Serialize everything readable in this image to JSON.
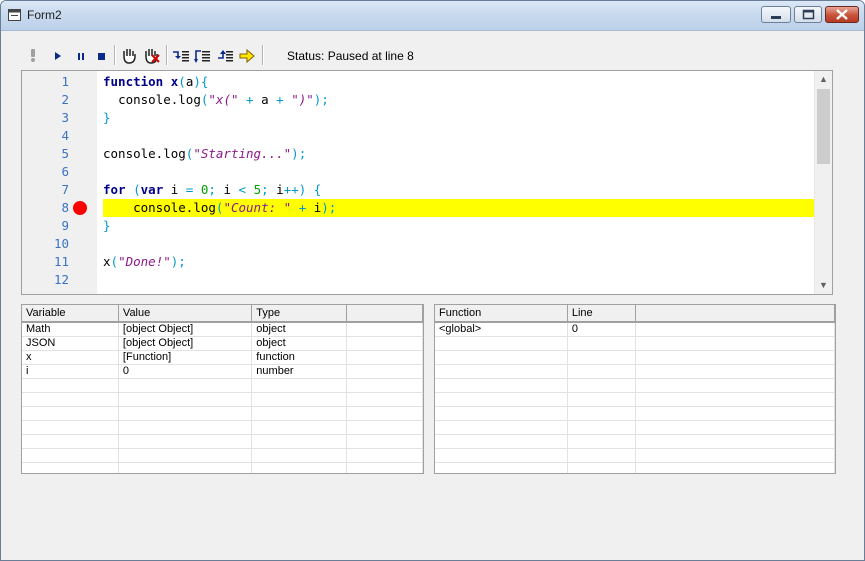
{
  "window": {
    "title": "Form2"
  },
  "toolbar": {
    "buttons": [
      {
        "name": "run-icon"
      },
      {
        "name": "continue-icon"
      },
      {
        "name": "pause-icon"
      },
      {
        "name": "stop-icon"
      },
      {
        "name": "toggle-breakpoint-icon"
      },
      {
        "name": "clear-breakpoints-icon"
      },
      {
        "name": "step-into-icon"
      },
      {
        "name": "step-over-icon"
      },
      {
        "name": "step-out-icon"
      },
      {
        "name": "show-next-statement-icon"
      }
    ],
    "status": "Status: Paused at line 8"
  },
  "editor": {
    "current_line": 8,
    "breakpoint_line": 8,
    "line_numbers": [
      "1",
      "2",
      "3",
      "4",
      "5",
      "6",
      "7",
      "8",
      "9",
      "10",
      "11",
      "12"
    ],
    "tokens": {
      "l1_kw": "function",
      "l1_name": " x",
      "l1_open": "(",
      "l1_arg": "a",
      "l1_close": "){",
      "l2_indent": "  ",
      "l2_fn": "console.log",
      "l2_open": "(",
      "l2_str1": "\"x(\"",
      "l2_plus1": " + ",
      "l2_a": "a",
      "l2_plus2": " + ",
      "l2_str2": "\")\"",
      "l2_close": ");",
      "l3_brace": "}",
      "l5_fn": "console.log",
      "l5_open": "(",
      "l5_str": "\"Starting...\"",
      "l5_close": ");",
      "l7_for": "for",
      "l7_sp": " ",
      "l7_open": "(",
      "l7_var": "var",
      "l7_i": " i ",
      "l7_eq": "=",
      "l7_sp2": " ",
      "l7_zero": "0",
      "l7_semi": ";",
      "l7_i2": " i ",
      "l7_lt": "<",
      "l7_sp3": " ",
      "l7_five": "5",
      "l7_semi2": ";",
      "l7_inc": " i",
      "l7_pp": "++",
      "l7_close": ")",
      "l7_brace": " {",
      "l8_indent": "    ",
      "l8_fn": "console.log",
      "l8_open": "(",
      "l8_str": "\"Count: \"",
      "l8_plus": " + ",
      "l8_i": "i",
      "l8_close": ");",
      "l9_brace": "}",
      "l11_x": "x",
      "l11_open": "(",
      "l11_str": "\"Done!\"",
      "l11_close": ");"
    }
  },
  "variables": {
    "columns": [
      "Variable",
      "Value",
      "Type",
      ""
    ],
    "rows": [
      {
        "name": "Math",
        "value": "[object Object]",
        "type": "object"
      },
      {
        "name": "JSON",
        "value": "[object Object]",
        "type": "object"
      },
      {
        "name": "x",
        "value": "[Function]",
        "type": "function"
      },
      {
        "name": "i",
        "value": "0",
        "type": "number"
      }
    ]
  },
  "callstack": {
    "columns": [
      "Function",
      "Line",
      ""
    ],
    "rows": [
      {
        "function": "<global>",
        "line": "0"
      }
    ]
  },
  "colors": {
    "highlight": "#ffff00",
    "breakpoint": "#ff0000",
    "keyword": "#00008b",
    "string": "#8b1a8b",
    "number": "#00a000",
    "punctuation": "#0099cc",
    "line_number": "#3a72c6"
  }
}
